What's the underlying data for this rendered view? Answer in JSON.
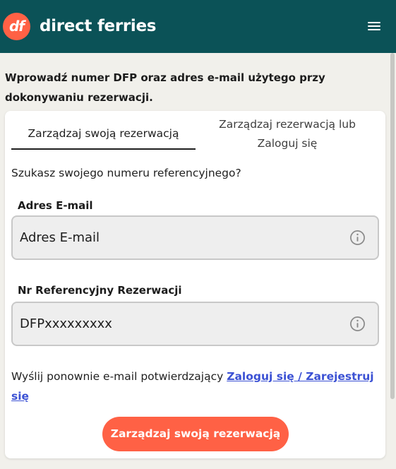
{
  "header": {
    "logo_text": "df",
    "brand": "direct ferries",
    "menu_icon": "hamburger-menu-icon",
    "background_color": "#0b5257",
    "logo_color": "#ff6145"
  },
  "instruction": "Wprowadź numer DFP oraz adres e-mail użytego przy dokonywaniu rezerwacji.",
  "tabs": [
    {
      "label": "Zarządzaj swoją rezerwacją",
      "active": true
    },
    {
      "label": "Zarządzaj rezerwacją lub Zaloguj się",
      "active": false
    }
  ],
  "reference_question": "Szukasz swojego numeru referencyjnego?",
  "fields": {
    "email": {
      "label": "Adres E-mail",
      "placeholder": "Adres E-mail",
      "value": "",
      "icon": "info-icon"
    },
    "reference": {
      "label": "Nr Referencyjny Rezerwacji",
      "placeholder": "DFPxxxxxxxxx",
      "value": "",
      "icon": "info-icon"
    }
  },
  "resend": {
    "text": "Wyślij ponownie e-mail potwierdzający ",
    "link": "Zaloguj się / Zarejestruj się"
  },
  "submit_button": {
    "label": "Zarządzaj swoją rezerwacją",
    "color": "#ff6145"
  },
  "colors": {
    "page_background": "#f1f0eb",
    "link": "#3b51d4"
  }
}
